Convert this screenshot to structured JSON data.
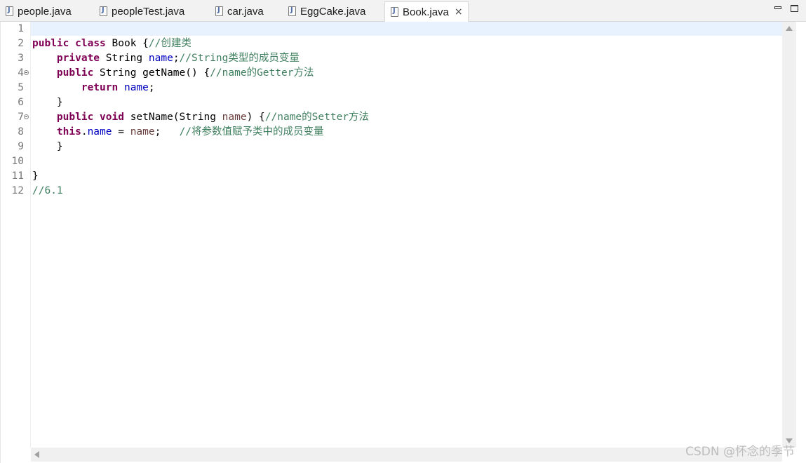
{
  "tabs": [
    {
      "label": "people.java",
      "icon": "java-file-icon"
    },
    {
      "label": "peopleTest.java",
      "icon": "java-file-icon"
    },
    {
      "label": "car.java",
      "icon": "java-file-icon"
    },
    {
      "label": "EggCake.java",
      "icon": "java-file-icon"
    },
    {
      "label": "Book.java",
      "icon": "java-file-icon",
      "active": true,
      "close": "×"
    }
  ],
  "editor": {
    "line_numbers": [
      "1",
      "2",
      "3",
      "4",
      "5",
      "6",
      "7",
      "8",
      "9",
      "10",
      "11",
      "12"
    ],
    "lines": {
      "l2": {
        "kw1": "public",
        "kw2": "class",
        "name": "Book",
        "brace": "{",
        "comment": "//创建类"
      },
      "l3": {
        "kw": "private",
        "type": "String",
        "field": "name",
        "semi": ";",
        "comment": "//String类型的成员变量"
      },
      "l4": {
        "kw": "public",
        "sig": "String getName() {",
        "comment": "//name的Getter方法"
      },
      "l5": {
        "kw": "return",
        "field": "name",
        "semi": ";"
      },
      "l6": {
        "text": "}"
      },
      "l7": {
        "kw1": "public",
        "kw2": "void",
        "sig": "setName(String",
        "param": "name",
        "close": ") {",
        "comment": "//name的Setter方法"
      },
      "l8": {
        "kw": "this",
        "dot": ".",
        "field": "name",
        "eq": " = ",
        "param": "name",
        "semi": ";",
        "comment": "//将参数值赋予类中的成员变量"
      },
      "l9": {
        "text": "}"
      },
      "l11": {
        "text": "}"
      },
      "l12": {
        "comment": "//6.1"
      }
    }
  },
  "colors": {
    "keyword": "#7f0055",
    "field": "#0000c0",
    "comment": "#3f7f5f",
    "parameter": "#6a3e3e",
    "current_line": "#e8f2fe"
  },
  "watermark": "CSDN @怀念的季节"
}
